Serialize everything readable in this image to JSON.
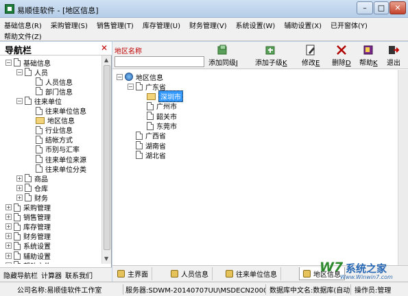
{
  "window": {
    "title": "易顺佳软件 - [地区信息]",
    "min_symbol": "–",
    "max_symbol": "□",
    "close_symbol": "✕"
  },
  "menu": {
    "row1": [
      "基础信息(R)",
      "采购管理(S)",
      "销售管理(T)",
      "库存管理(U)",
      "财务管理(V)",
      "系统设置(W)",
      "辅助设置(X)",
      "已开窗体(Y)"
    ],
    "row2": [
      "帮助文件(Z)"
    ]
  },
  "nav": {
    "title": "导航栏",
    "close_symbol": "✕",
    "footer": [
      "隐藏导航栏",
      "计算器",
      "联系我们"
    ],
    "tree": [
      {
        "label": "基础信息",
        "level": 0,
        "exp": "-",
        "icon": "doc"
      },
      {
        "label": "人员",
        "level": 1,
        "exp": "-",
        "icon": "doc"
      },
      {
        "label": "人员信息",
        "level": 2,
        "exp": "",
        "icon": "doc"
      },
      {
        "label": "部门信息",
        "level": 2,
        "exp": "",
        "icon": "doc"
      },
      {
        "label": "往来单位",
        "level": 1,
        "exp": "-",
        "icon": "doc"
      },
      {
        "label": "往来单位信息",
        "level": 2,
        "exp": "",
        "icon": "doc"
      },
      {
        "label": "地区信息",
        "level": 2,
        "exp": "",
        "icon": "folder"
      },
      {
        "label": "行业信息",
        "level": 2,
        "exp": "",
        "icon": "doc"
      },
      {
        "label": "结帐方式",
        "level": 2,
        "exp": "",
        "icon": "doc"
      },
      {
        "label": "币别与汇率",
        "level": 2,
        "exp": "",
        "icon": "doc"
      },
      {
        "label": "往来单位来源",
        "level": 2,
        "exp": "",
        "icon": "doc"
      },
      {
        "label": "往来单位分类",
        "level": 2,
        "exp": "",
        "icon": "doc"
      },
      {
        "label": "商品",
        "level": 1,
        "exp": "+",
        "icon": "doc"
      },
      {
        "label": "仓库",
        "level": 1,
        "exp": "+",
        "icon": "doc"
      },
      {
        "label": "财务",
        "level": 1,
        "exp": "+",
        "icon": "doc"
      },
      {
        "label": "采购管理",
        "level": 0,
        "exp": "+",
        "icon": "doc"
      },
      {
        "label": "销售管理",
        "level": 0,
        "exp": "+",
        "icon": "doc"
      },
      {
        "label": "库存管理",
        "level": 0,
        "exp": "+",
        "icon": "doc"
      },
      {
        "label": "财务管理",
        "level": 0,
        "exp": "+",
        "icon": "doc"
      },
      {
        "label": "系统设置",
        "level": 0,
        "exp": "+",
        "icon": "doc"
      },
      {
        "label": "辅助设置",
        "level": 0,
        "exp": "+",
        "icon": "doc"
      },
      {
        "label": "帮助文件",
        "level": 0,
        "exp": "+",
        "icon": "doc"
      }
    ]
  },
  "filter": {
    "label": "地区名称",
    "value": ""
  },
  "toolbar": [
    {
      "label": "添加同级",
      "key": "J",
      "icon": "add-sibling-icon"
    },
    {
      "label": "添加子级",
      "key": "K",
      "icon": "add-child-icon"
    },
    {
      "label": "修改",
      "key": "E",
      "icon": "edit-icon"
    },
    {
      "label": "删除",
      "key": "D",
      "icon": "delete-icon"
    },
    {
      "label": "帮助",
      "key": "K",
      "icon": "help-book-icon"
    },
    {
      "label": "退出",
      "key": "",
      "icon": "exit-icon"
    }
  ],
  "area_tree": [
    {
      "label": "地区信息",
      "level": 0,
      "exp": "-",
      "icon": "globe",
      "selected": false
    },
    {
      "label": "广东省",
      "level": 1,
      "exp": "-",
      "icon": "doc",
      "selected": false
    },
    {
      "label": "深圳市",
      "level": 2,
      "exp": "",
      "icon": "folder",
      "selected": true
    },
    {
      "label": "广州市",
      "level": 2,
      "exp": "",
      "icon": "doc",
      "selected": false
    },
    {
      "label": "韶关市",
      "level": 2,
      "exp": "",
      "icon": "doc",
      "selected": false
    },
    {
      "label": "东莞市",
      "level": 2,
      "exp": "",
      "icon": "doc",
      "selected": false
    },
    {
      "label": "广西省",
      "level": 1,
      "exp": "",
      "icon": "doc",
      "selected": false
    },
    {
      "label": "湖南省",
      "level": 1,
      "exp": "",
      "icon": "doc",
      "selected": false
    },
    {
      "label": "湖北省",
      "level": 1,
      "exp": "",
      "icon": "doc",
      "selected": false
    }
  ],
  "tabs": [
    {
      "label": "主界面",
      "active": false
    },
    {
      "label": "人员信息",
      "active": false
    },
    {
      "label": "往来单位信息",
      "active": false
    },
    {
      "label": "地区信息",
      "active": true
    }
  ],
  "status": {
    "company": "公司名称:易顺佳软件工作室",
    "server": "服务器:SDWM-20140707UU\\MSDECN2000",
    "db": "数据库中文名:数据库(自动)",
    "operator": "操作员:管理"
  },
  "watermark": {
    "logo": "W7",
    "text": "系统之家",
    "url": "Www.Winwin7.com"
  }
}
